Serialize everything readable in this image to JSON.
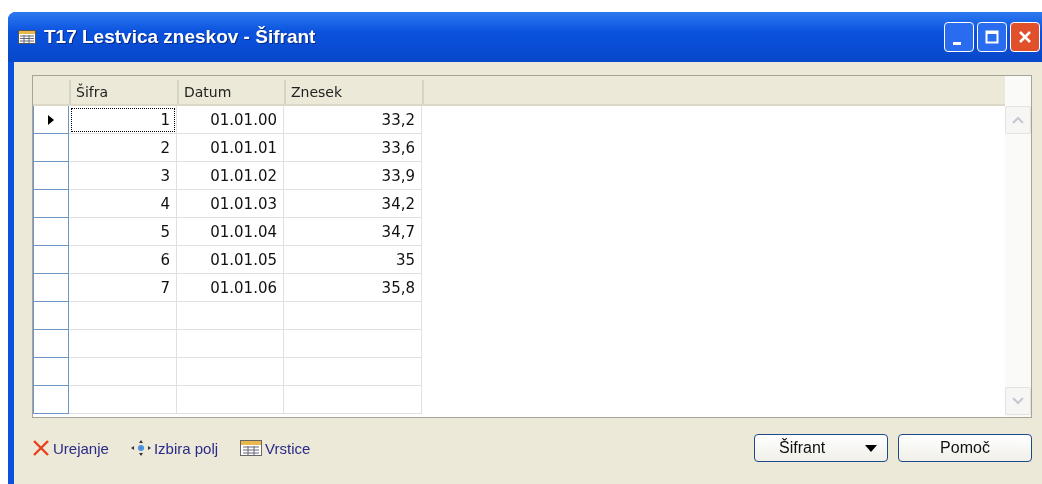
{
  "window": {
    "title": "T17 Lestvica zneskov - Šifrant"
  },
  "table": {
    "columns": [
      "Šifra",
      "Datum",
      "Znesek"
    ],
    "rows": [
      {
        "cells": [
          "1",
          "01.01.00",
          "33,2"
        ],
        "selected": true
      },
      {
        "cells": [
          "2",
          "01.01.01",
          "33,6"
        ],
        "selected": false
      },
      {
        "cells": [
          "3",
          "01.01.02",
          "33,9"
        ],
        "selected": false
      },
      {
        "cells": [
          "4",
          "01.01.03",
          "34,2"
        ],
        "selected": false
      },
      {
        "cells": [
          "5",
          "01.01.04",
          "34,7"
        ],
        "selected": false
      },
      {
        "cells": [
          "6",
          "01.01.05",
          "35"
        ],
        "selected": false
      },
      {
        "cells": [
          "7",
          "01.01.06",
          "35,8"
        ],
        "selected": false
      }
    ]
  },
  "toolbar": [
    {
      "kind": "edit",
      "label": "Urejanje"
    },
    {
      "kind": "fields",
      "label": "Izbira polj"
    },
    {
      "kind": "rows",
      "label": "Vrstice"
    }
  ],
  "buttons": [
    {
      "label": "Šifrant",
      "dropdown": true
    },
    {
      "label": "Pomoč",
      "dropdown": false
    }
  ]
}
